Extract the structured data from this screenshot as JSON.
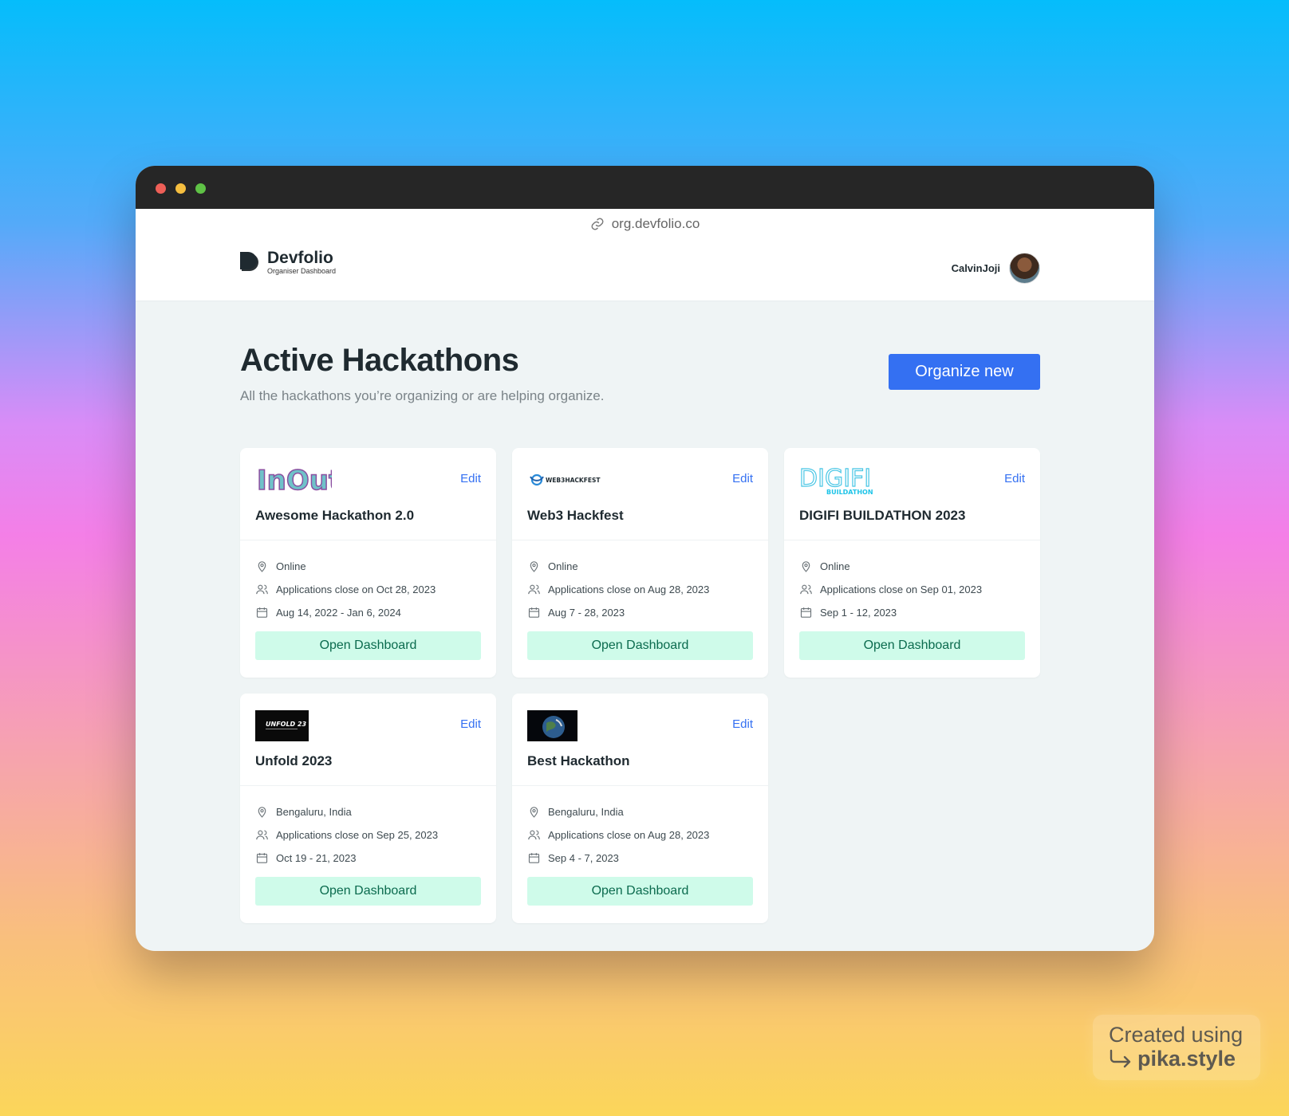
{
  "browser": {
    "url": "org.devfolio.co"
  },
  "header": {
    "brand_name": "Devfolio",
    "brand_subtitle": "Organiser Dashboard",
    "user_name": "CalvinJoji"
  },
  "main": {
    "title": "Active Hackathons",
    "subtitle": "All the hackathons you’re organizing or are helping organize.",
    "organize_button": "Organize new"
  },
  "labels": {
    "edit": "Edit",
    "open_dashboard": "Open Dashboard"
  },
  "hackathons": [
    {
      "logo_text": "InOut",
      "name": "Awesome Hackathon 2.0",
      "location": "Online",
      "applications": "Applications close on Oct 28, 2023",
      "dates": "Aug 14, 2022 - Jan 6, 2024"
    },
    {
      "logo_text": "WEB3HACKFEST",
      "name": "Web3 Hackfest",
      "location": "Online",
      "applications": "Applications close on Aug 28, 2023",
      "dates": "Aug 7 - 28, 2023"
    },
    {
      "logo_text": "DIGIFI",
      "logo_subtext": "BUILDATHON",
      "name": "DIGIFI BUILDATHON 2023",
      "location": "Online",
      "applications": "Applications close on Sep 01, 2023",
      "dates": "Sep 1 - 12, 2023"
    },
    {
      "logo_text": "UNFOLD 23",
      "name": "Unfold 2023",
      "location": "Bengaluru, India",
      "applications": "Applications close on Sep 25, 2023",
      "dates": "Oct 19 - 21, 2023"
    },
    {
      "name": "Best Hackathon",
      "location": "Bengaluru, India",
      "applications": "Applications close on Aug 28, 2023",
      "dates": "Sep 4 - 7, 2023"
    }
  ],
  "watermark": {
    "line1": "Created using",
    "line2": "pika.style"
  },
  "colors": {
    "accent": "#3470f2",
    "open_button_bg": "#cffbea",
    "open_button_text": "#0b6b4e"
  }
}
